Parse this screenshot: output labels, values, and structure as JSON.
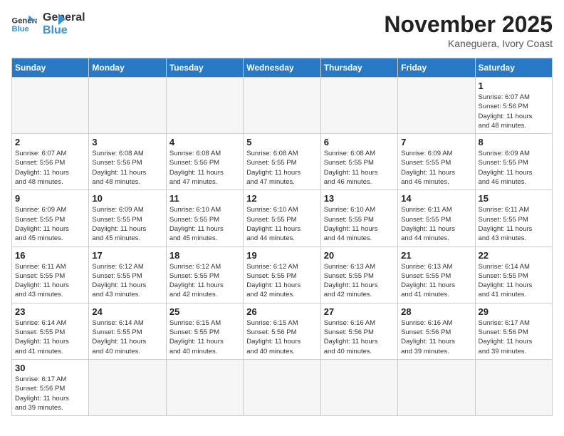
{
  "header": {
    "logo_text_general": "General",
    "logo_text_blue": "Blue",
    "month_title": "November 2025",
    "subtitle": "Kaneguera, Ivory Coast"
  },
  "weekdays": [
    "Sunday",
    "Monday",
    "Tuesday",
    "Wednesday",
    "Thursday",
    "Friday",
    "Saturday"
  ],
  "weeks": [
    [
      {
        "day": "",
        "info": ""
      },
      {
        "day": "",
        "info": ""
      },
      {
        "day": "",
        "info": ""
      },
      {
        "day": "",
        "info": ""
      },
      {
        "day": "",
        "info": ""
      },
      {
        "day": "",
        "info": ""
      },
      {
        "day": "1",
        "info": "Sunrise: 6:07 AM\nSunset: 5:56 PM\nDaylight: 11 hours\nand 48 minutes."
      }
    ],
    [
      {
        "day": "2",
        "info": "Sunrise: 6:07 AM\nSunset: 5:56 PM\nDaylight: 11 hours\nand 48 minutes."
      },
      {
        "day": "3",
        "info": "Sunrise: 6:08 AM\nSunset: 5:56 PM\nDaylight: 11 hours\nand 48 minutes."
      },
      {
        "day": "4",
        "info": "Sunrise: 6:08 AM\nSunset: 5:56 PM\nDaylight: 11 hours\nand 47 minutes."
      },
      {
        "day": "5",
        "info": "Sunrise: 6:08 AM\nSunset: 5:55 PM\nDaylight: 11 hours\nand 47 minutes."
      },
      {
        "day": "6",
        "info": "Sunrise: 6:08 AM\nSunset: 5:55 PM\nDaylight: 11 hours\nand 46 minutes."
      },
      {
        "day": "7",
        "info": "Sunrise: 6:09 AM\nSunset: 5:55 PM\nDaylight: 11 hours\nand 46 minutes."
      },
      {
        "day": "8",
        "info": "Sunrise: 6:09 AM\nSunset: 5:55 PM\nDaylight: 11 hours\nand 46 minutes."
      }
    ],
    [
      {
        "day": "9",
        "info": "Sunrise: 6:09 AM\nSunset: 5:55 PM\nDaylight: 11 hours\nand 45 minutes."
      },
      {
        "day": "10",
        "info": "Sunrise: 6:09 AM\nSunset: 5:55 PM\nDaylight: 11 hours\nand 45 minutes."
      },
      {
        "day": "11",
        "info": "Sunrise: 6:10 AM\nSunset: 5:55 PM\nDaylight: 11 hours\nand 45 minutes."
      },
      {
        "day": "12",
        "info": "Sunrise: 6:10 AM\nSunset: 5:55 PM\nDaylight: 11 hours\nand 44 minutes."
      },
      {
        "day": "13",
        "info": "Sunrise: 6:10 AM\nSunset: 5:55 PM\nDaylight: 11 hours\nand 44 minutes."
      },
      {
        "day": "14",
        "info": "Sunrise: 6:11 AM\nSunset: 5:55 PM\nDaylight: 11 hours\nand 44 minutes."
      },
      {
        "day": "15",
        "info": "Sunrise: 6:11 AM\nSunset: 5:55 PM\nDaylight: 11 hours\nand 43 minutes."
      }
    ],
    [
      {
        "day": "16",
        "info": "Sunrise: 6:11 AM\nSunset: 5:55 PM\nDaylight: 11 hours\nand 43 minutes."
      },
      {
        "day": "17",
        "info": "Sunrise: 6:12 AM\nSunset: 5:55 PM\nDaylight: 11 hours\nand 43 minutes."
      },
      {
        "day": "18",
        "info": "Sunrise: 6:12 AM\nSunset: 5:55 PM\nDaylight: 11 hours\nand 42 minutes."
      },
      {
        "day": "19",
        "info": "Sunrise: 6:12 AM\nSunset: 5:55 PM\nDaylight: 11 hours\nand 42 minutes."
      },
      {
        "day": "20",
        "info": "Sunrise: 6:13 AM\nSunset: 5:55 PM\nDaylight: 11 hours\nand 42 minutes."
      },
      {
        "day": "21",
        "info": "Sunrise: 6:13 AM\nSunset: 5:55 PM\nDaylight: 11 hours\nand 41 minutes."
      },
      {
        "day": "22",
        "info": "Sunrise: 6:14 AM\nSunset: 5:55 PM\nDaylight: 11 hours\nand 41 minutes."
      }
    ],
    [
      {
        "day": "23",
        "info": "Sunrise: 6:14 AM\nSunset: 5:55 PM\nDaylight: 11 hours\nand 41 minutes."
      },
      {
        "day": "24",
        "info": "Sunrise: 6:14 AM\nSunset: 5:55 PM\nDaylight: 11 hours\nand 40 minutes."
      },
      {
        "day": "25",
        "info": "Sunrise: 6:15 AM\nSunset: 5:55 PM\nDaylight: 11 hours\nand 40 minutes."
      },
      {
        "day": "26",
        "info": "Sunrise: 6:15 AM\nSunset: 5:56 PM\nDaylight: 11 hours\nand 40 minutes."
      },
      {
        "day": "27",
        "info": "Sunrise: 6:16 AM\nSunset: 5:56 PM\nDaylight: 11 hours\nand 40 minutes."
      },
      {
        "day": "28",
        "info": "Sunrise: 6:16 AM\nSunset: 5:56 PM\nDaylight: 11 hours\nand 39 minutes."
      },
      {
        "day": "29",
        "info": "Sunrise: 6:17 AM\nSunset: 5:56 PM\nDaylight: 11 hours\nand 39 minutes."
      }
    ],
    [
      {
        "day": "30",
        "info": "Sunrise: 6:17 AM\nSunset: 5:56 PM\nDaylight: 11 hours\nand 39 minutes."
      },
      {
        "day": "",
        "info": ""
      },
      {
        "day": "",
        "info": ""
      },
      {
        "day": "",
        "info": ""
      },
      {
        "day": "",
        "info": ""
      },
      {
        "day": "",
        "info": ""
      },
      {
        "day": "",
        "info": ""
      }
    ]
  ]
}
